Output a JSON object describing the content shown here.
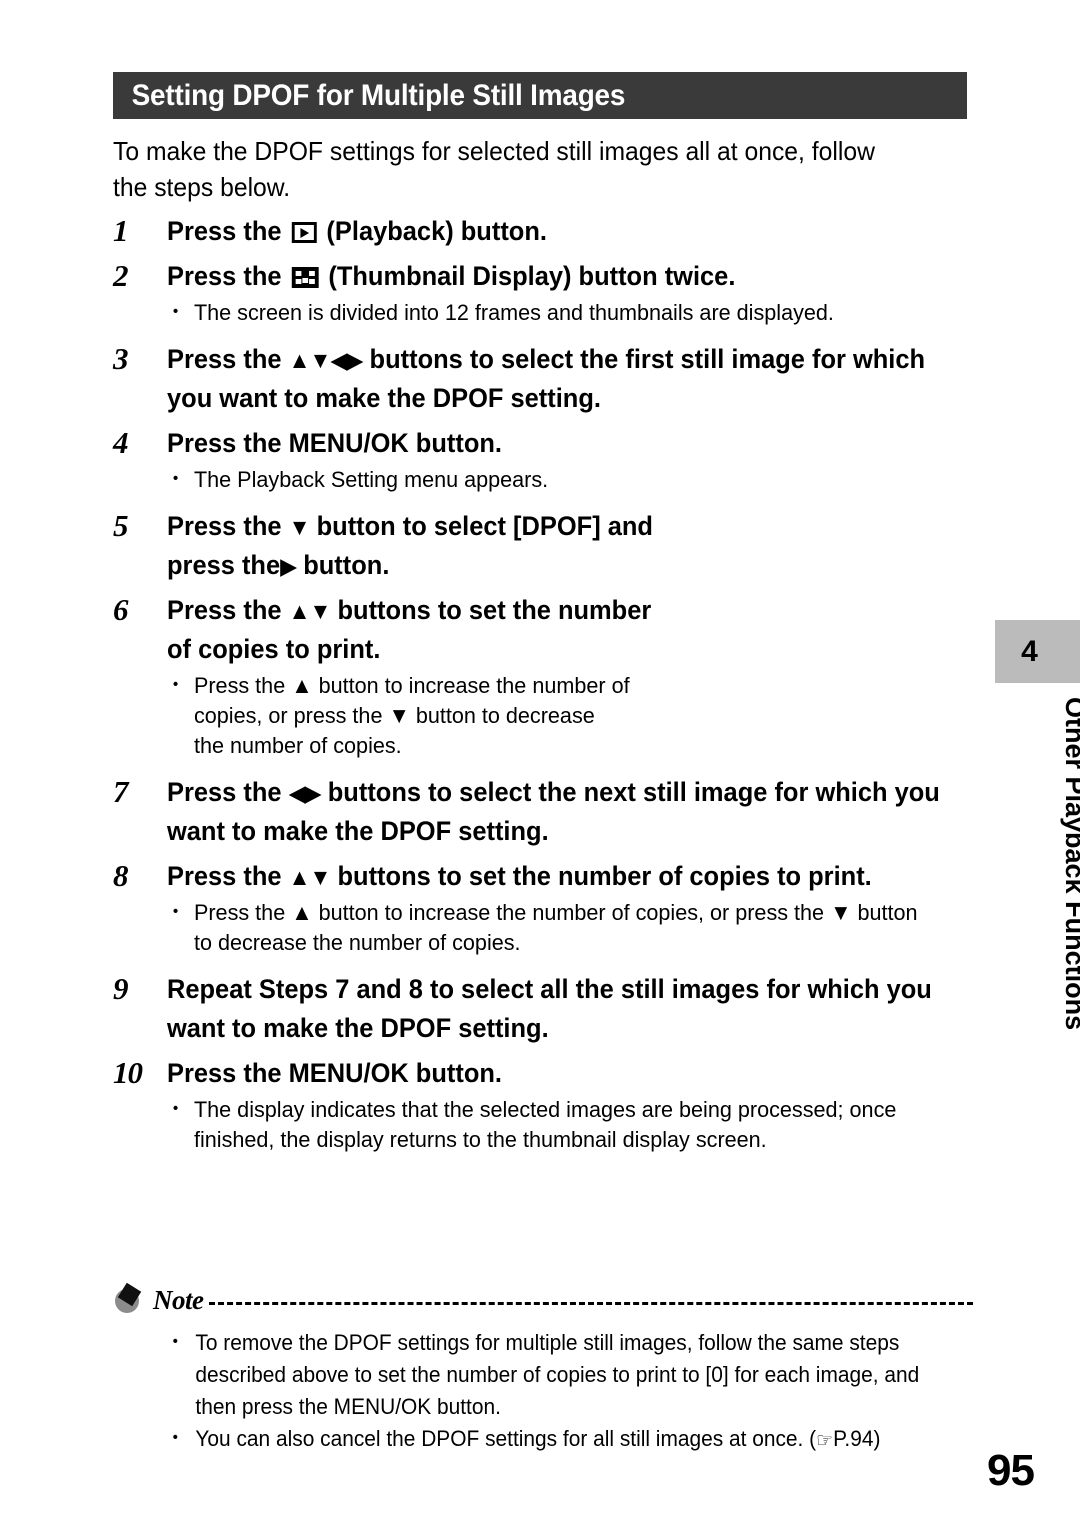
{
  "page": {
    "number": "95",
    "title": "Setting DPOF for Multiple Still Images",
    "intro": "To make the DPOF settings for selected still images all at once, follow the steps below."
  },
  "side_tab": {
    "chapter_number": "4",
    "chapter_label": "Other Playback Functions",
    "box_color": "#bbbbbb"
  },
  "icons": {
    "playback": "playback-button-icon",
    "thumbnail": "thumbnail-display-button-icon",
    "up_arrow": "▲",
    "down_arrow": "▼",
    "left_arrow": "◀",
    "right_arrow": "▶",
    "note": "note-icon",
    "reference": "☞"
  },
  "steps": [
    {
      "number": "1",
      "text_before": "Press the",
      "icon": "playback",
      "text_after": "(Playback) button.",
      "bullets": []
    },
    {
      "number": "2",
      "text_before": "Press the",
      "icon": "thumbnail",
      "text_after": "(Thumbnail Display) button twice.",
      "bullets": [
        "The screen is divided into 12 frames and thumbnails are displayed."
      ]
    },
    {
      "number": "3",
      "text_before": "Press the",
      "arrows": "▲▼◀▶",
      "text_after": "buttons to select the first still image for which you want to make the DPOF setting.",
      "bullets": []
    },
    {
      "number": "4",
      "text_full": "Press the MENU/OK button.",
      "bullets": [
        "The Playback Setting menu appears."
      ]
    },
    {
      "number": "5",
      "text_before": "Press the",
      "arrows": "▼",
      "text_mid": "button to select [DPOF] and press the",
      "arrows2": "▶",
      "text_after": "button.",
      "bullets": []
    },
    {
      "number": "6",
      "text_before": "Press the",
      "arrows": "▲▼",
      "text_after": "buttons to set the number of copies to print.",
      "bullets": [
        "Press the ▲ button to increase the number of copies, or press the ▼ button to decrease the number of copies."
      ]
    },
    {
      "number": "7",
      "text_before": "Press the",
      "arrows": "◀▶",
      "text_after": "buttons to select the next still image for which you want to make the DPOF setting.",
      "bullets": []
    },
    {
      "number": "8",
      "text_before": "Press the",
      "arrows": "▲▼",
      "text_after": "buttons to set the number of copies to print.",
      "bullets": [
        "Press the ▲ button to increase the number of copies, or press the ▼ button to decrease the number of copies."
      ]
    },
    {
      "number": "9",
      "text_full": "Repeat Steps 7 and 8 to select all the still images for which you want to make the DPOF setting.",
      "bullets": []
    },
    {
      "number": "10",
      "text_full": "Press the MENU/OK button.",
      "bullets": [
        "The display indicates that the selected images are being processed; once finished, the display returns to the thumbnail display screen."
      ]
    }
  ],
  "note": {
    "label": "Note",
    "bullets": [
      "To remove the DPOF settings for multiple still images, follow the same steps described above to set the number of copies to print to [0] for each image, and then press the MENU/OK button.",
      "You can also cancel the DPOF settings for all still images at once. ("
    ],
    "reference_page": "P.94)"
  },
  "colors": {
    "banner_bg": "#3a3a3a",
    "banner_text": "#ffffff",
    "body_text": "#000000",
    "tab_gray": "#bbbbbb"
  }
}
